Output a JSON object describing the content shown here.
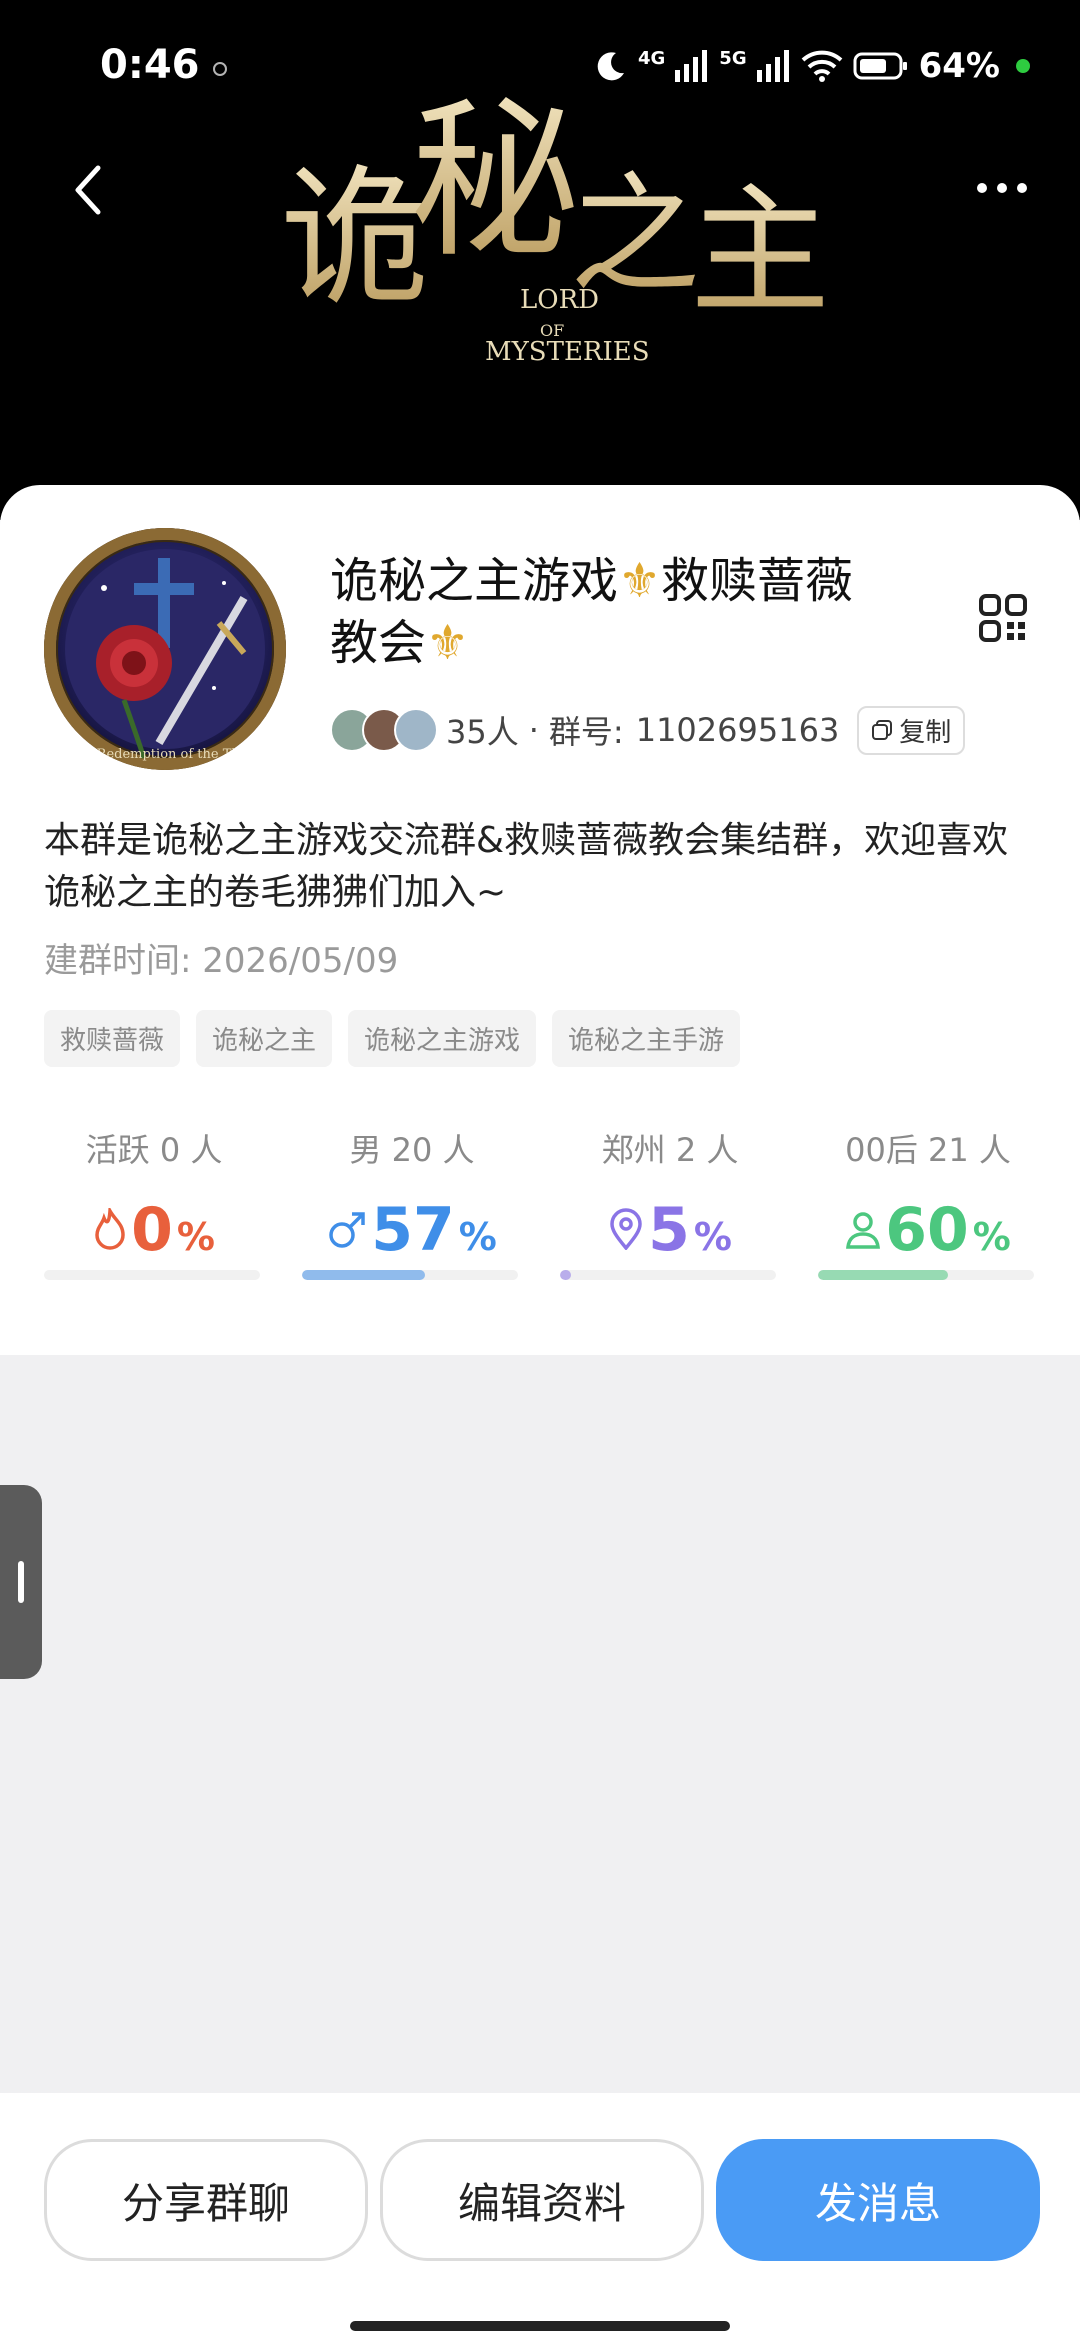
{
  "status_bar": {
    "time": "0:46",
    "network_1": "4G",
    "network_2": "5G",
    "battery": "64%"
  },
  "header": {
    "back_icon": "chevron-left-icon",
    "more_icon": "more-horizontal-icon",
    "logo_title": "诡秘之主",
    "logo_subtitle": "LORD OF MYSTERIES"
  },
  "group": {
    "name": "诡秘之主游戏⚜️救赎蔷薇教会⚜️",
    "name_part1": "诡秘之主游戏",
    "name_part2": "救赎蔷薇",
    "name_part3": "教会",
    "members": "35人",
    "separator": "·",
    "group_no_label": "群号:",
    "group_no": "1102695163",
    "copy_label": "复制",
    "description": "本群是诡秘之主游戏交流群&救赎蔷薇教会集结群，欢迎喜欢诡秘之主的卷毛狒狒们加入~",
    "created_label": "建群时间:",
    "created_date": "2026/05/09",
    "avatar_text": "The Redemption of the Thorn"
  },
  "tags": [
    "救赎蔷薇",
    "诡秘之主",
    "诡秘之主游戏",
    "诡秘之主手游"
  ],
  "stats": [
    {
      "label": "活跃 0 人",
      "value": "0",
      "unit": "%",
      "icon": "flame-icon",
      "color": "#e8603c",
      "fraction": 0.0
    },
    {
      "label": "男 20 人",
      "value": "57",
      "unit": "%",
      "icon": "male-icon",
      "color": "#3f8ee8",
      "fraction": 0.57
    },
    {
      "label": "郑州 2 人",
      "value": "5",
      "unit": "%",
      "icon": "location-icon",
      "color": "#8a74e6",
      "fraction": 0.05
    },
    {
      "label": "00后 21 人",
      "value": "60",
      "unit": "%",
      "icon": "person-icon",
      "color": "#4cc77f",
      "fraction": 0.6
    }
  ],
  "actions": {
    "share": "分享群聊",
    "edit": "编辑资料",
    "send": "发消息"
  }
}
